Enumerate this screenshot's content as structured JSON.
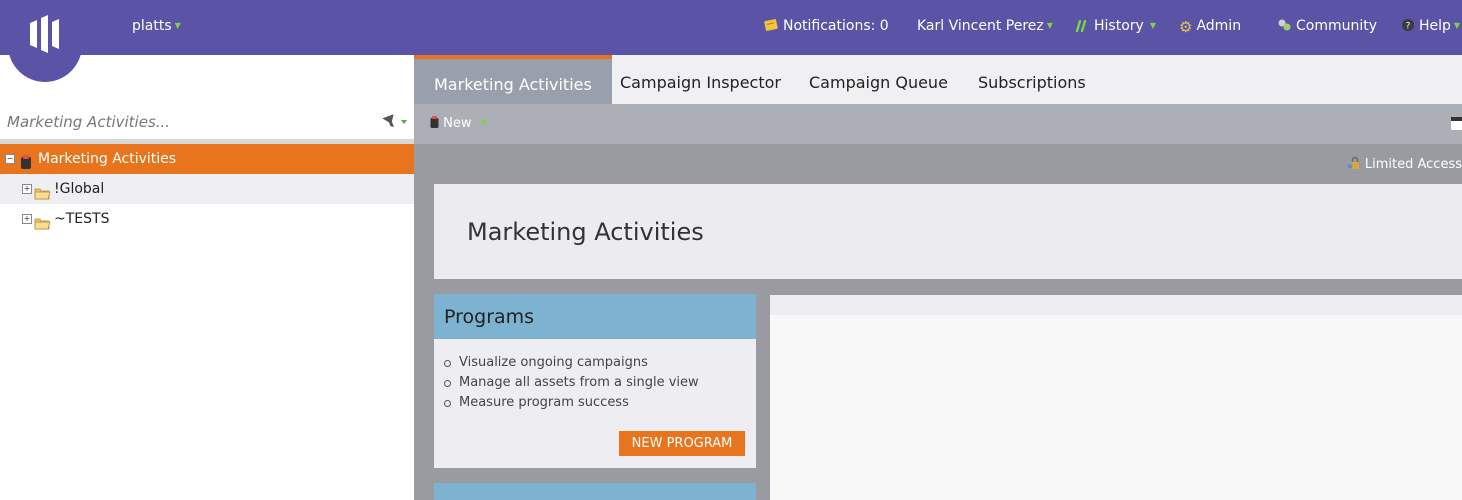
{
  "topbar": {
    "workspace": "platts",
    "notifications": "Notifications: 0",
    "user": "Karl Vincent Perez",
    "history": "History",
    "admin": "Admin",
    "community": "Community",
    "help": "Help",
    "accent_color": "#5a53a6",
    "caret_color": "#7cd34a"
  },
  "left": {
    "search_placeholder": "Marketing Activities...",
    "tree": [
      {
        "label": "Marketing Activities",
        "icon": "marketing-activities-icon",
        "selected": true
      },
      {
        "label": "!Global",
        "icon": "folder-icon"
      },
      {
        "label": "~TESTS",
        "icon": "folder-icon"
      }
    ]
  },
  "tabs": [
    "Marketing Activities",
    "Campaign Inspector",
    "Campaign Queue",
    "Subscriptions"
  ],
  "toolbar": {
    "new_label": "New"
  },
  "content": {
    "limited_access": "Limited Access",
    "hero_title": "Marketing Activities",
    "programs": {
      "title": "Programs",
      "items": [
        "Visualize ongoing campaigns",
        "Manage all assets from a single view",
        "Measure program success"
      ],
      "button": "NEW PROGRAM"
    }
  },
  "colors": {
    "orange": "#e9741e",
    "card_header": "#7db3d0"
  }
}
